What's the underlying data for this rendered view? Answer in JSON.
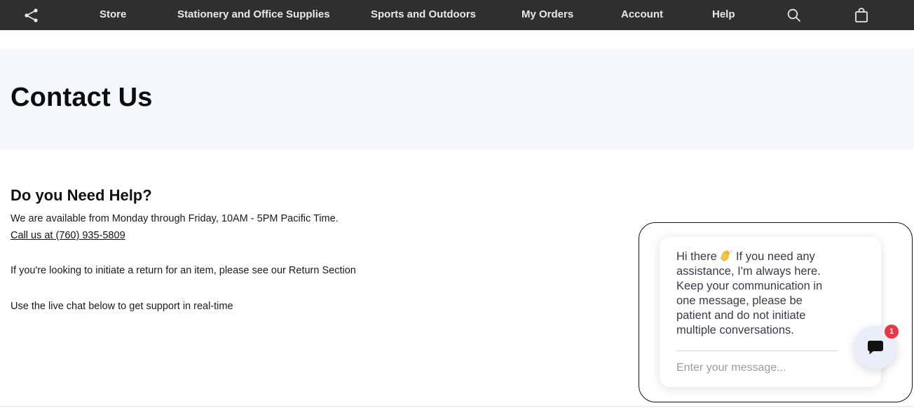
{
  "nav": {
    "items": [
      {
        "label": "Store"
      },
      {
        "label": "Stationery and Office Supplies"
      },
      {
        "label": "Sports and Outdoors"
      },
      {
        "label": "My Orders"
      },
      {
        "label": "Account"
      },
      {
        "label": "Help"
      }
    ],
    "icons": [
      "share-icon",
      "search-icon",
      "shopping-bag-icon"
    ]
  },
  "hero": {
    "title": "Contact Us"
  },
  "help": {
    "heading": "Do you Need Help?",
    "availability": "We are available from Monday through Friday, 10AM - 5PM Pacific Time.",
    "call_link": "Call us at (760) 935-5809",
    "return_text": "If you're looking to initiate a return for an item, please see our Return Section",
    "chat_text": "Use the live chat below to get support in real-time"
  },
  "chat": {
    "message_prefix": "Hi there",
    "message_rest": "If you need any assistance, I'm always here. Keep your communication in one message, please be patient and do not initiate multiple conversations.",
    "input_placeholder": "Enter your message...",
    "badge_count": "1",
    "colors": {
      "badge": "#e63946",
      "launcher": "#e9eef8"
    }
  }
}
